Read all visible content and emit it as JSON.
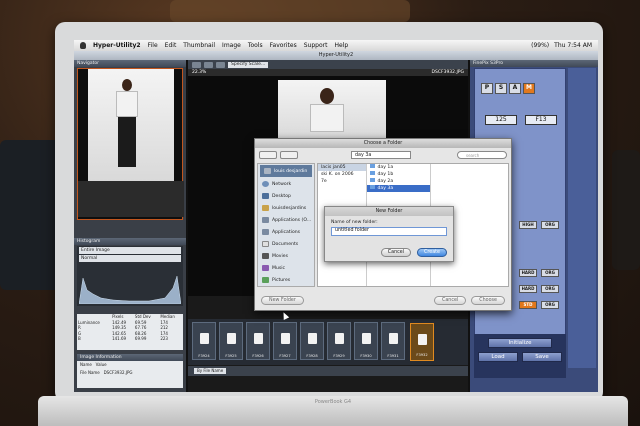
{
  "menubar": {
    "app": "Hyper-Utility2",
    "items": [
      "File",
      "Edit",
      "Thumbnail",
      "Image",
      "Tools",
      "Favorites",
      "Support",
      "Help"
    ],
    "battery": "(99%)",
    "clock": "Thu 7:54 AM"
  },
  "window": {
    "title": "Hyper-Utility2"
  },
  "left_panel": {
    "navigator_title": "Navigator",
    "histogram_title": "Histogram",
    "hist_select_1": "Entire Image",
    "hist_select_2": "Normal",
    "stats_header": [
      "",
      "Pixels",
      "Std Dev",
      "Median"
    ],
    "stats_rows": [
      [
        "Luminance",
        "142.49",
        "69.59",
        "174"
      ],
      [
        "R",
        "149.35",
        "67.76",
        "212"
      ],
      [
        "G",
        "142.65",
        "68.26",
        "174"
      ],
      [
        "B",
        "141.69",
        "69.99",
        "223"
      ]
    ],
    "info_title": "Image Information",
    "info_rows": [
      [
        "Name",
        "Value"
      ],
      [
        "File Name",
        "DSCF3932.JPG"
      ]
    ]
  },
  "main": {
    "scale_select": "Specify Scale...",
    "zoom": "22.3%",
    "filename": "DSCF3932.JPG",
    "thumbnails": [
      "F3924",
      "F3925",
      "F3926",
      "F3927",
      "F3928",
      "F3929",
      "F3930",
      "F3931",
      "F3932"
    ],
    "thumb_sort": "By File Name"
  },
  "dialog": {
    "title": "Choose a Folder",
    "location": "day 3a",
    "search_placeholder": "search",
    "sidebar": [
      "louis desjardin",
      "Network",
      "Desktop",
      "louisdesjardins",
      "Applications (O...",
      "Applications",
      "Documents",
      "Movies",
      "Music",
      "Pictures"
    ],
    "col1": [
      "lacis jan05",
      "ski K. on 2006",
      "7e"
    ],
    "col2": [
      "day 1a",
      "day 1b",
      "day 2a",
      "day 3a"
    ],
    "new_folder_btn": "New Folder",
    "cancel_btn": "Cancel",
    "choose_btn": "Choose"
  },
  "sheet": {
    "title": "New Folder",
    "label": "Name of new folder:",
    "value": "untitled folder",
    "cancel": "Cancel",
    "create": "Create"
  },
  "right_panel": {
    "title": "FinePix S3Pro",
    "mode_buttons": [
      "P",
      "S",
      "A",
      "M"
    ],
    "shutter": "125",
    "aperture": "F13",
    "labels": [
      "HIGH",
      "ORG",
      "HARD",
      "ORG",
      "HARD",
      "ORG",
      "STD",
      "ORG"
    ],
    "initialize": "Initialize",
    "load": "Load",
    "save": "Save"
  },
  "colors": {
    "accent_orange": "#e2781c",
    "panel_blue": "#7f93c9",
    "select_blue": "#3a6dc7"
  }
}
